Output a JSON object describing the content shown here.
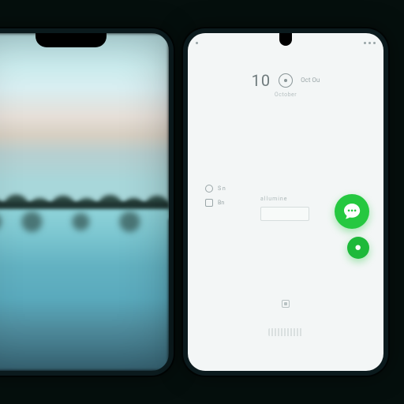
{
  "scene": {
    "background_color": "#050f0d"
  },
  "left_phone": {
    "wallpaper": {
      "label": "lake-landscape-wallpaper"
    }
  },
  "right_phone": {
    "status": {
      "time": ""
    },
    "clock": {
      "digits": "10",
      "label_top": "Oct Ou",
      "label_sub": "October"
    },
    "mid": {
      "item1": "S n",
      "item2": "Bn",
      "label": "allumine",
      "box_label": ""
    },
    "fab": {
      "primary": "chat",
      "secondary": "record"
    },
    "dock": {
      "hint": ""
    }
  },
  "accent": "#25c840"
}
